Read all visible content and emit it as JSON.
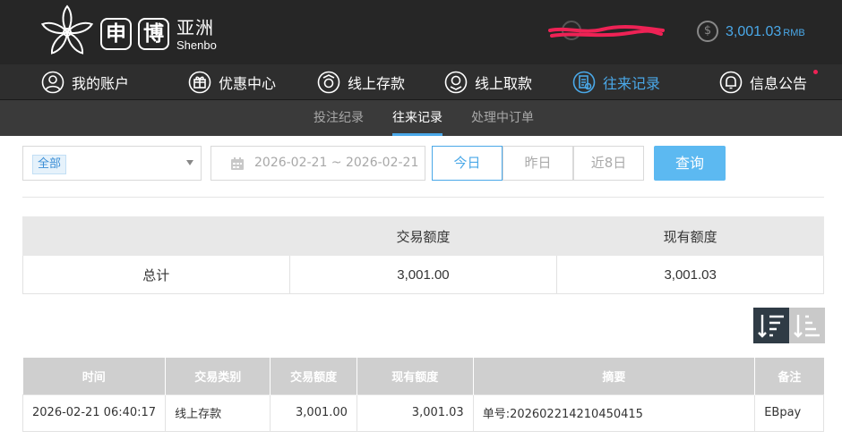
{
  "header": {
    "logo_char1": "申",
    "logo_char2": "博",
    "logo_cn": "亚洲",
    "logo_en": "Shenbo",
    "user_name": "",
    "balance_icon": "$",
    "balance": "3,001.03",
    "currency": "RMB"
  },
  "nav": {
    "items": [
      {
        "label": "我的账户",
        "icon": "user-icon"
      },
      {
        "label": "优惠中心",
        "icon": "gift-icon"
      },
      {
        "label": "线上存款",
        "icon": "deposit-icon"
      },
      {
        "label": "线上取款",
        "icon": "withdraw-icon"
      },
      {
        "label": "往来记录",
        "icon": "records-icon"
      },
      {
        "label": "信息公告",
        "icon": "bell-icon"
      }
    ],
    "active": "往来记录"
  },
  "subnav": {
    "items": [
      "投注纪录",
      "往来记录",
      "处理中订单"
    ],
    "active": "往来记录"
  },
  "filter": {
    "type_selected": "全部",
    "date_range": "2026-02-21 ~ 2026-02-21",
    "quick_today": "今日",
    "quick_yesterday": "昨日",
    "quick_8days": "近8日",
    "search_label": "查询"
  },
  "summary": {
    "headers": [
      "",
      "交易额度",
      "现有额度"
    ],
    "row": {
      "label": "总计",
      "amount": "3,001.00",
      "balance": "3,001.03"
    }
  },
  "records": {
    "headers": [
      "时间",
      "交易类别",
      "交易额度",
      "现有额度",
      "摘要",
      "备注"
    ],
    "rows": [
      [
        "2026-02-21 06:40:17",
        "线上存款",
        "3,001.00",
        "3,001.03",
        "单号:202602214210450415",
        "EBpay"
      ]
    ]
  },
  "colors": {
    "accent": "#4aa8e8",
    "header_bg": "#262626",
    "nav_bg": "#2e2e2e",
    "subnav_bg": "#3a3a3a",
    "redact": "#ee2255"
  }
}
